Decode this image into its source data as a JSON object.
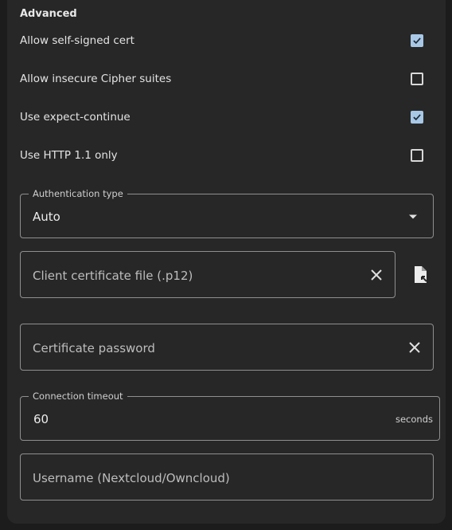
{
  "section_title": "Advanced",
  "toggles": [
    {
      "label": "Allow self-signed cert",
      "checked": true
    },
    {
      "label": "Allow insecure Cipher suites",
      "checked": false
    },
    {
      "label": "Use expect-continue",
      "checked": true
    },
    {
      "label": "Use HTTP 1.1 only",
      "checked": false
    }
  ],
  "auth_type": {
    "legend": "Authentication type",
    "value": "Auto"
  },
  "client_cert": {
    "placeholder": "Client certificate file (.p12)"
  },
  "cert_password": {
    "placeholder": "Certificate password"
  },
  "connection_timeout": {
    "legend": "Connection timeout",
    "value": "60",
    "suffix": "seconds"
  },
  "username": {
    "placeholder": "Username (Nextcloud/Owncloud)"
  },
  "colors": {
    "accent": "#a8c8e6",
    "surface": "#272727",
    "background": "#1c1c1c",
    "outline": "#8f8f8f"
  }
}
